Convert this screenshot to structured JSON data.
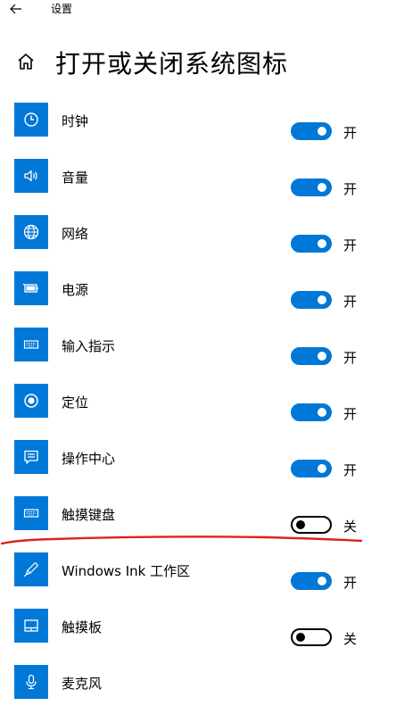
{
  "app": {
    "title": "设置",
    "back_icon": "back-arrow-icon"
  },
  "header": {
    "home_icon": "home-icon",
    "title": "打开或关闭系统图标"
  },
  "colors": {
    "accent": "#0078d7",
    "annotation": "#e02020"
  },
  "items": [
    {
      "label": "时钟",
      "icon": "clock-icon",
      "state": "on",
      "state_text": "开"
    },
    {
      "label": "音量",
      "icon": "volume-icon",
      "state": "on",
      "state_text": "开"
    },
    {
      "label": "网络",
      "icon": "network-globe-icon",
      "state": "on",
      "state_text": "开"
    },
    {
      "label": "电源",
      "icon": "battery-icon",
      "state": "on",
      "state_text": "开"
    },
    {
      "label": "输入指示",
      "icon": "keyboard-icon",
      "state": "on",
      "state_text": "开"
    },
    {
      "label": "定位",
      "icon": "location-icon",
      "state": "on",
      "state_text": "开"
    },
    {
      "label": "操作中心",
      "icon": "action-center-icon",
      "state": "on",
      "state_text": "开"
    },
    {
      "label": "触摸键盘",
      "icon": "touch-keyboard-icon",
      "state": "off",
      "state_text": "关"
    },
    {
      "label": "Windows Ink 工作区",
      "icon": "pen-icon",
      "state": "on",
      "state_text": "开"
    },
    {
      "label": "触摸板",
      "icon": "touchpad-icon",
      "state": "off",
      "state_text": "关"
    },
    {
      "label": "麦克风",
      "icon": "microphone-icon",
      "state": "",
      "state_text": ""
    }
  ]
}
